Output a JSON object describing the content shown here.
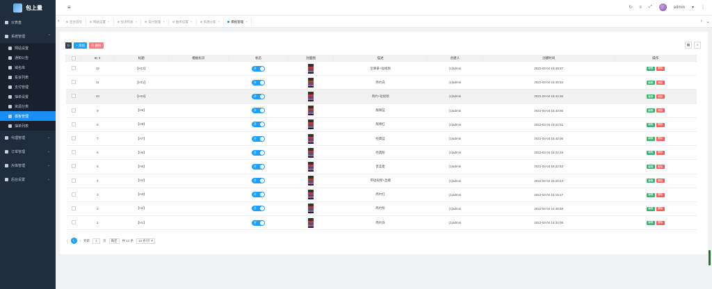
{
  "brand": {
    "name": "包上量"
  },
  "sidebar": {
    "dashboard": "仪表盘",
    "system": "系统管理",
    "subitems": [
      {
        "label": "网站设置",
        "icon": "gear-icon"
      },
      {
        "label": "通知公告",
        "icon": "bell-icon"
      },
      {
        "label": "域名库",
        "icon": "link-icon"
      },
      {
        "label": "投诉列表",
        "icon": "check-square-icon"
      },
      {
        "label": "支付管理",
        "icon": "card-icon"
      },
      {
        "label": "抽单设置",
        "icon": "bank-icon"
      },
      {
        "label": "资源分类",
        "icon": "tree-icon"
      },
      {
        "label": "模板管理",
        "icon": "template-icon",
        "active": true
      },
      {
        "label": "抽单列表",
        "icon": "list-icon"
      }
    ],
    "agent": "代理管理",
    "orders": "订单管理",
    "slice": "片库管理",
    "backend": "后台设置"
  },
  "topbar": {
    "user": "admin",
    "user_caret": "▾"
  },
  "tabs": [
    {
      "label": "后台首页",
      "close": false
    },
    {
      "label": "网站设置",
      "close": true
    },
    {
      "label": "投诉列表",
      "close": true
    },
    {
      "label": "支付管理",
      "close": true
    },
    {
      "label": "抽单设置",
      "close": true
    },
    {
      "label": "资源分类",
      "close": true
    },
    {
      "label": "模板管理",
      "close": true,
      "active": true
    }
  ],
  "toolbar": {
    "add": "+ 添加",
    "delete": "⊖ 删除"
  },
  "table": {
    "headers": [
      "ID ⇕",
      "标题",
      "模板标识",
      "状态",
      "封面图",
      "描述",
      "创建人",
      "创建时间",
      "操作"
    ],
    "switch_on": "开",
    "edit_label": "编辑",
    "del_label": "删除",
    "rows": [
      {
        "id": "12",
        "title": "【H12】",
        "desc": "至尊豪+短视频",
        "creator": "(1)admin",
        "time": "2022-04-04 15:48:37"
      },
      {
        "id": "11",
        "title": "【H11】",
        "desc": "简约白",
        "creator": "(1)admin",
        "time": "2022-04-04 15:45:52"
      },
      {
        "id": "10",
        "title": "【H10】",
        "desc": "简约+短视频",
        "creator": "(1)admin",
        "time": "2022-04-04 15:44:36",
        "highlight": true
      },
      {
        "id": "9",
        "title": "【H9】",
        "desc": "靓辣蓝",
        "creator": "(1)admin",
        "time": "2022-04-04 15:43:56"
      },
      {
        "id": "8",
        "title": "【H8】",
        "desc": "靓辣红",
        "creator": "(1)admin",
        "time": "2022-04-04 15:42:51"
      },
      {
        "id": "7",
        "title": "【H7】",
        "desc": "经典蓝",
        "creator": "(1)admin",
        "time": "2022-04-04 15:42:06"
      },
      {
        "id": "6",
        "title": "【H6】",
        "desc": "经典粉",
        "creator": "(1)admin",
        "time": "2022-04-04 15:24:48"
      },
      {
        "id": "5",
        "title": "【H5】",
        "desc": "晋蓝麦",
        "creator": "(1)admin",
        "time": "2022-04-04 15:22:53"
      },
      {
        "id": "4",
        "title": "【H4】",
        "desc": "带短视频+直播",
        "creator": "(1)admin",
        "time": "2022-04-04 15:20:43"
      },
      {
        "id": "3",
        "title": "【H3】",
        "desc": "简约红",
        "creator": "(1)admin",
        "time": "2022-04-04 15:15:17"
      },
      {
        "id": "2",
        "title": "【H2】",
        "desc": "简约粉",
        "creator": "(1)admin",
        "time": "2022-04-04 14:48:58"
      },
      {
        "id": "1",
        "title": "【H1】",
        "desc": "简约白",
        "creator": "(1)admin",
        "time": "2022-04-04 14:32:05"
      }
    ]
  },
  "pager": {
    "current": "1",
    "goto_label": "到第",
    "goto_value": "1",
    "page_unit": "页",
    "confirm": "确定",
    "total": "共 12 条",
    "per_page": "15 条/页"
  },
  "colors": {
    "sidebar_bg": "#1f2d3d",
    "accent": "#1a8ef2",
    "edit": "#3cb371",
    "delete": "#f06060"
  }
}
